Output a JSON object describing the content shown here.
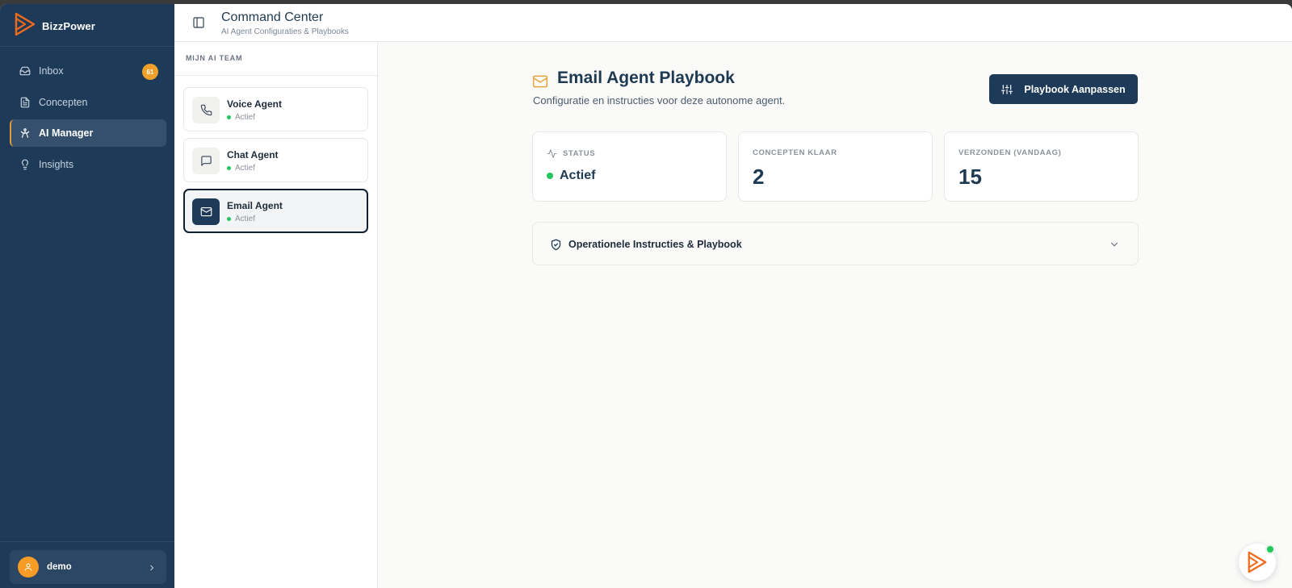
{
  "brand": {
    "name": "BizzPower"
  },
  "sidebar": {
    "items": [
      {
        "label": "Inbox",
        "icon": "inbox-icon",
        "badge": "61"
      },
      {
        "label": "Concepten",
        "icon": "document-icon"
      },
      {
        "label": "AI Manager",
        "icon": "ai-manager-icon",
        "active": true
      },
      {
        "label": "Insights",
        "icon": "lightbulb-icon"
      }
    ],
    "user": {
      "name": "demo"
    }
  },
  "header": {
    "title": "Command Center",
    "subtitle": "AI Agent Configuraties & Playbooks"
  },
  "team": {
    "title": "MIJN AI TEAM",
    "agents": [
      {
        "name": "Voice Agent",
        "status": "Actief",
        "icon": "phone-icon"
      },
      {
        "name": "Chat Agent",
        "status": "Actief",
        "icon": "chat-icon"
      },
      {
        "name": "Email Agent",
        "status": "Actief",
        "icon": "mail-icon",
        "selected": true
      }
    ]
  },
  "main": {
    "title": "Email Agent Playbook",
    "subtitle": "Configuratie en instructies voor deze autonome agent.",
    "button_label": "Playbook Aanpassen",
    "stats": [
      {
        "label": "STATUS",
        "value": "Actief"
      },
      {
        "label": "CONCEPTEN KLAAR",
        "value": "2"
      },
      {
        "label": "VERZONDEN (VANDAAG)",
        "value": "15"
      }
    ],
    "accordion": {
      "label": "Operationele Instructies & Playbook"
    }
  },
  "colors": {
    "sidebar": "#1d3a58",
    "accent": "#f59b26",
    "status_green": "#22c55e",
    "primary_button": "#1d3a58"
  }
}
